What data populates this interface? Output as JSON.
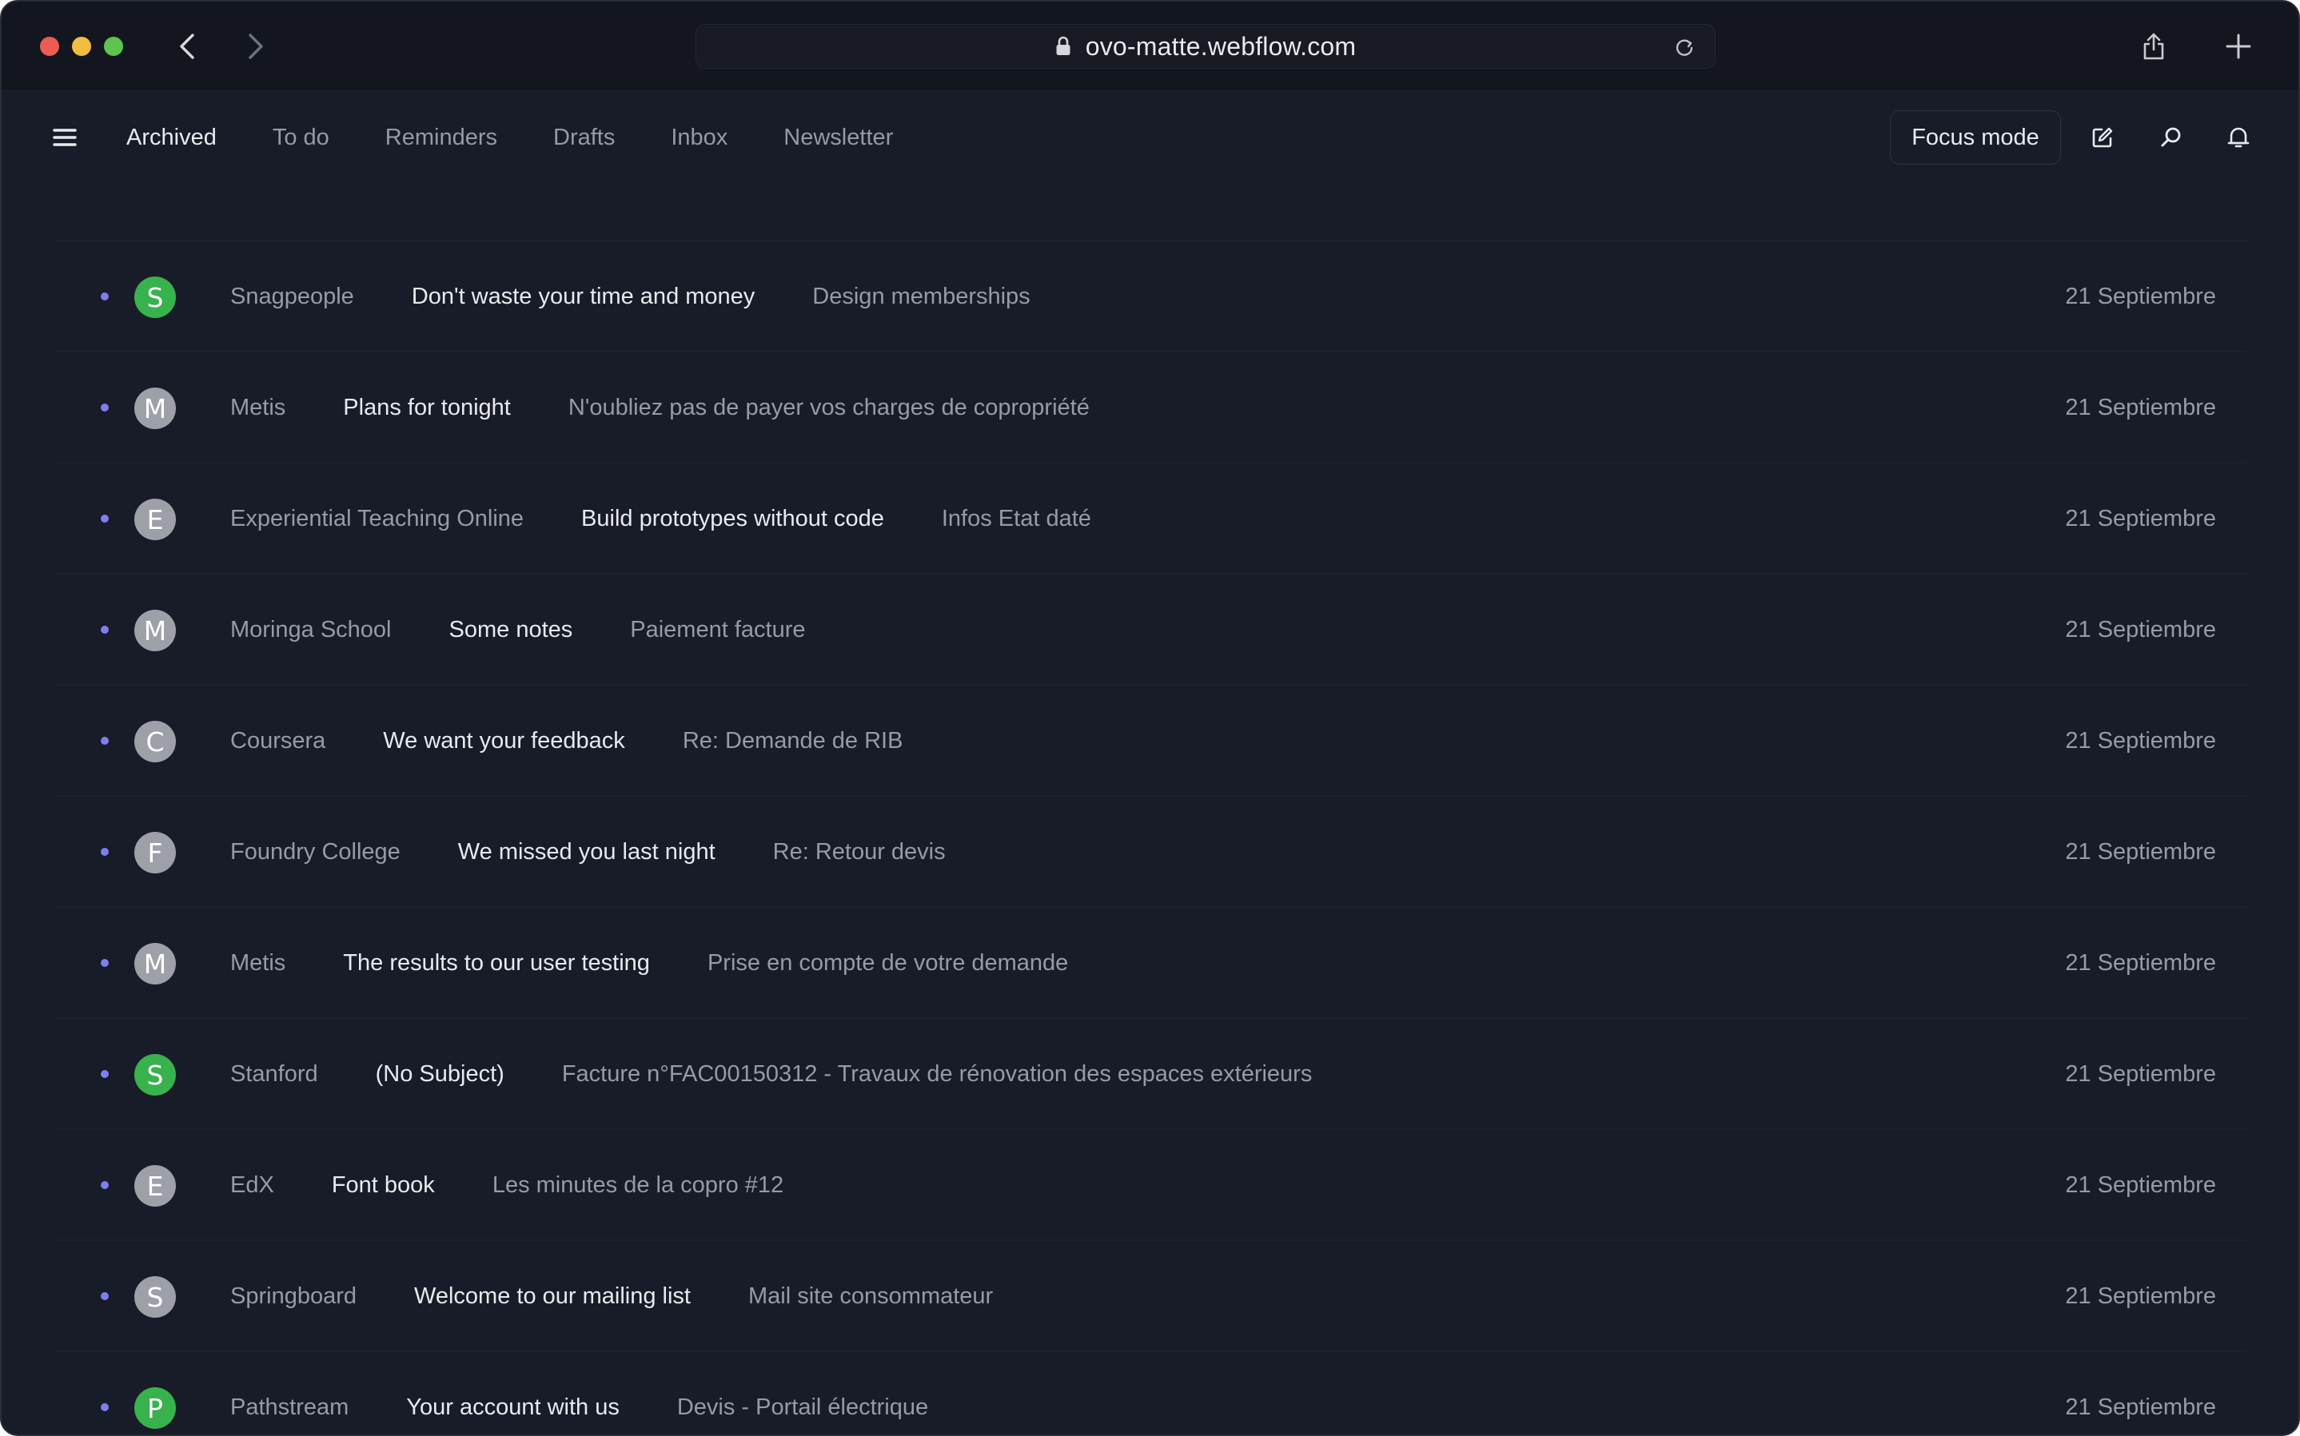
{
  "browser": {
    "url": "ovo-matte.webflow.com"
  },
  "toolbar": {
    "tabs": [
      {
        "label": "Archived",
        "active": true
      },
      {
        "label": "To do",
        "active": false
      },
      {
        "label": "Reminders",
        "active": false
      },
      {
        "label": "Drafts",
        "active": false
      },
      {
        "label": "Inbox",
        "active": false
      },
      {
        "label": "Newsletter",
        "active": false
      }
    ],
    "focus_label": "Focus mode",
    "icons": [
      "menu-icon",
      "compose-icon",
      "search-icon",
      "bell-icon"
    ]
  },
  "colors": {
    "background": "#181b28",
    "unread_dot": "#7b80f0",
    "avatar_green": "#37b24d",
    "avatar_grey": "#9ea0a9"
  },
  "mails": [
    {
      "initial": "S",
      "avatar_color": "green",
      "sender": "Snagpeople",
      "subject": "Don't waste your time and money",
      "preview": "Design memberships",
      "date": "21 Septiembre"
    },
    {
      "initial": "M",
      "avatar_color": "grey",
      "sender": "Metis",
      "subject": "Plans for tonight",
      "preview": "N'oubliez pas de payer vos charges de copropriété",
      "date": "21 Septiembre"
    },
    {
      "initial": "E",
      "avatar_color": "grey",
      "sender": "Experiential Teaching Online",
      "subject": "Build prototypes without code",
      "preview": "Infos Etat daté",
      "date": "21 Septiembre"
    },
    {
      "initial": "M",
      "avatar_color": "grey",
      "sender": "Moringa School",
      "subject": "Some notes",
      "preview": "Paiement facture",
      "date": "21 Septiembre"
    },
    {
      "initial": "C",
      "avatar_color": "grey",
      "sender": "Coursera",
      "subject": "We want your feedback",
      "preview": "Re: Demande de RIB",
      "date": "21 Septiembre"
    },
    {
      "initial": "F",
      "avatar_color": "grey",
      "sender": "Foundry College",
      "subject": "We missed you last night",
      "preview": "Re: Retour devis",
      "date": "21 Septiembre"
    },
    {
      "initial": "M",
      "avatar_color": "grey",
      "sender": "Metis",
      "subject": "The results to our user testing",
      "preview": "Prise en compte de votre demande",
      "date": "21 Septiembre"
    },
    {
      "initial": "S",
      "avatar_color": "green",
      "sender": "Stanford",
      "subject": "(No Subject)",
      "preview": "Facture n°FAC00150312 - Travaux de rénovation des espaces extérieurs",
      "date": "21 Septiembre"
    },
    {
      "initial": "E",
      "avatar_color": "grey",
      "sender": "EdX",
      "subject": "Font book",
      "preview": "Les minutes de la copro #12",
      "date": "21 Septiembre"
    },
    {
      "initial": "S",
      "avatar_color": "grey",
      "sender": "Springboard",
      "subject": "Welcome to our mailing list",
      "preview": "Mail site consommateur",
      "date": "21 Septiembre"
    },
    {
      "initial": "P",
      "avatar_color": "green",
      "sender": "Pathstream",
      "subject": "Your account with us",
      "preview": "Devis - Portail électrique",
      "date": "21 Septiembre"
    }
  ]
}
